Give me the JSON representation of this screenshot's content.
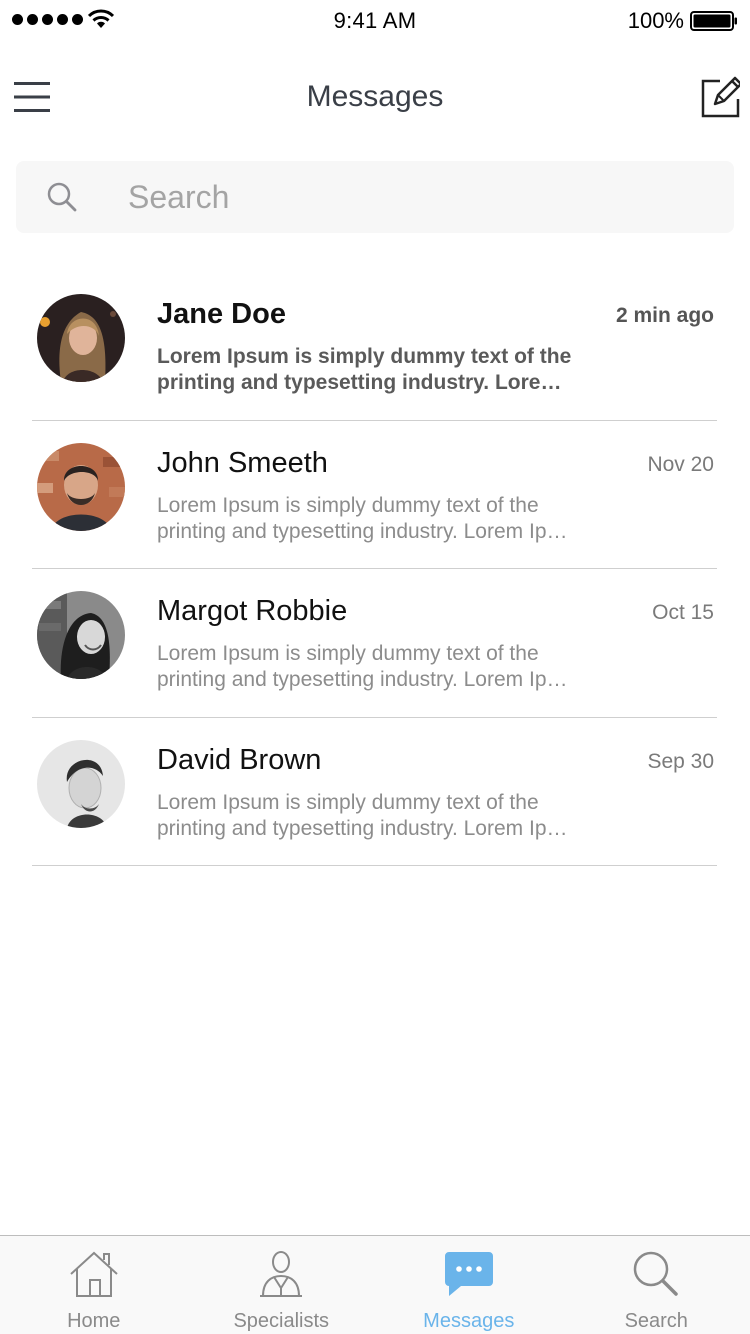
{
  "status_bar": {
    "time": "9:41 AM",
    "battery": "100%",
    "icons": [
      "signal-icon",
      "wifi-icon",
      "battery-icon"
    ]
  },
  "nav": {
    "title": "Messages",
    "left_icon": "menu-icon",
    "right_icon": "compose-icon"
  },
  "search": {
    "placeholder": "Search",
    "value": "",
    "icon": "search-icon"
  },
  "messages": [
    {
      "name": "Jane Doe",
      "time": "2 min ago",
      "preview_line1": "Lorem Ipsum is simply dummy text of the",
      "preview_line2": "printing and typesetting industry. Lorem Ipsum",
      "unread": true,
      "avatar": "avatar-jane"
    },
    {
      "name": "John Smeeth",
      "time": "Nov 20",
      "preview_line1": "Lorem Ipsum is simply dummy text of the",
      "preview_line2": "printing and typesetting industry. Lorem Ipsum",
      "unread": false,
      "avatar": "avatar-john"
    },
    {
      "name": "Margot Robbie",
      "time": "Oct 15",
      "preview_line1": "Lorem Ipsum is simply dummy text of the",
      "preview_line2": "printing and typesetting industry. Lorem Ipsum",
      "unread": false,
      "avatar": "avatar-margot"
    },
    {
      "name": "David Brown",
      "time": "Sep 30",
      "preview_line1": "Lorem Ipsum is simply dummy text of the",
      "preview_line2": "printing and typesetting industry. Lorem Ipsum",
      "unread": false,
      "avatar": "avatar-david"
    }
  ],
  "tabs": [
    {
      "label": "Home",
      "icon": "home-icon",
      "active": false
    },
    {
      "label": "Specialists",
      "icon": "specialist-icon",
      "active": false
    },
    {
      "label": "Messages",
      "icon": "chat-bubble-icon",
      "active": true
    },
    {
      "label": "Search",
      "icon": "search-icon",
      "active": false
    }
  ],
  "colors": {
    "accent": "#6ab4ea",
    "title": "#3a3f47",
    "muted": "#8c8c8c",
    "divider": "#cfcfcf"
  }
}
